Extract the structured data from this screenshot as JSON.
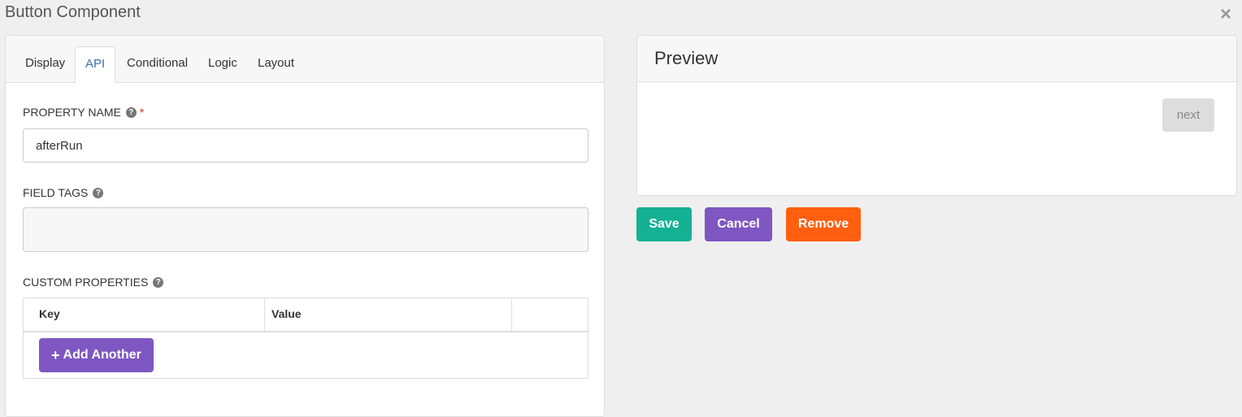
{
  "dialog": {
    "title": "Button Component",
    "close_symbol": "×"
  },
  "tabs": [
    {
      "label": "Display"
    },
    {
      "label": "API"
    },
    {
      "label": "Conditional"
    },
    {
      "label": "Logic"
    },
    {
      "label": "Layout"
    }
  ],
  "fields": {
    "property_name": {
      "label": "PROPERTY NAME",
      "required_mark": "*",
      "value": "afterRun"
    },
    "field_tags": {
      "label": "FIELD TAGS"
    },
    "custom_properties": {
      "label": "CUSTOM PROPERTIES",
      "headers": [
        "Key",
        "Value",
        ""
      ],
      "add_label": "Add Another"
    }
  },
  "icons": {
    "help": "?",
    "plus": "+"
  },
  "preview": {
    "title": "Preview",
    "button_label": "next"
  },
  "actions": {
    "save": "Save",
    "cancel": "Cancel",
    "remove": "Remove"
  },
  "colors": {
    "save": "#14b194",
    "cancel": "#7e57c2",
    "remove": "#ff5f0f",
    "add": "#7e57c2"
  }
}
